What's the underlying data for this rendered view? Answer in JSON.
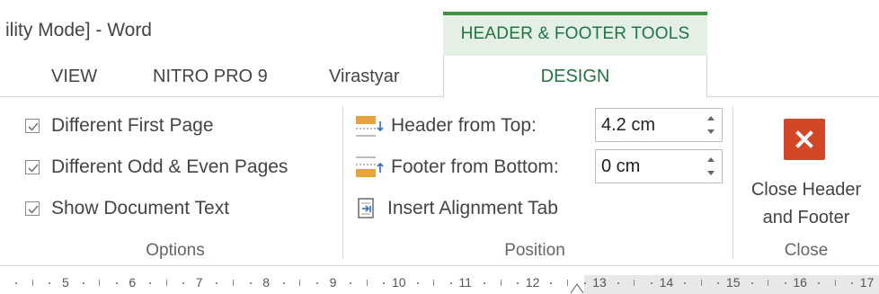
{
  "window": {
    "title": "ility Mode] - Word"
  },
  "contextual_group": {
    "label": "HEADER & FOOTER TOOLS",
    "color": "#3f9142"
  },
  "tabs": [
    {
      "label": "VIEW"
    },
    {
      "label": "NITRO PRO 9"
    },
    {
      "label": "Virastyar"
    }
  ],
  "active_tab": {
    "label": "DESIGN"
  },
  "options": {
    "items": [
      {
        "label": "Different First Page",
        "checked": true
      },
      {
        "label": "Different Odd & Even Pages",
        "checked": true
      },
      {
        "label": "Show Document Text",
        "checked": true
      }
    ],
    "group_label": "Options"
  },
  "position": {
    "header_from_top": {
      "label": "Header from Top:",
      "value": "4.2 cm",
      "icon": "header-from-top-icon"
    },
    "footer_from_bottom": {
      "label": "Footer from Bottom:",
      "value": "0 cm",
      "icon": "footer-from-bottom-icon"
    },
    "insert_alignment_tab": {
      "label": "Insert Alignment Tab",
      "icon": "insert-alignment-tab-icon"
    },
    "group_label": "Position"
  },
  "close": {
    "button_label_line1": "Close Header",
    "button_label_line2": "and Footer",
    "group_label": "Close",
    "icon": "close-x-icon",
    "icon_color": "#d24726"
  },
  "ruler": {
    "numbers": [
      "5",
      "6",
      "7",
      "8",
      "9",
      "10",
      "11",
      "12",
      "13",
      "14",
      "15",
      "16",
      "17"
    ]
  }
}
